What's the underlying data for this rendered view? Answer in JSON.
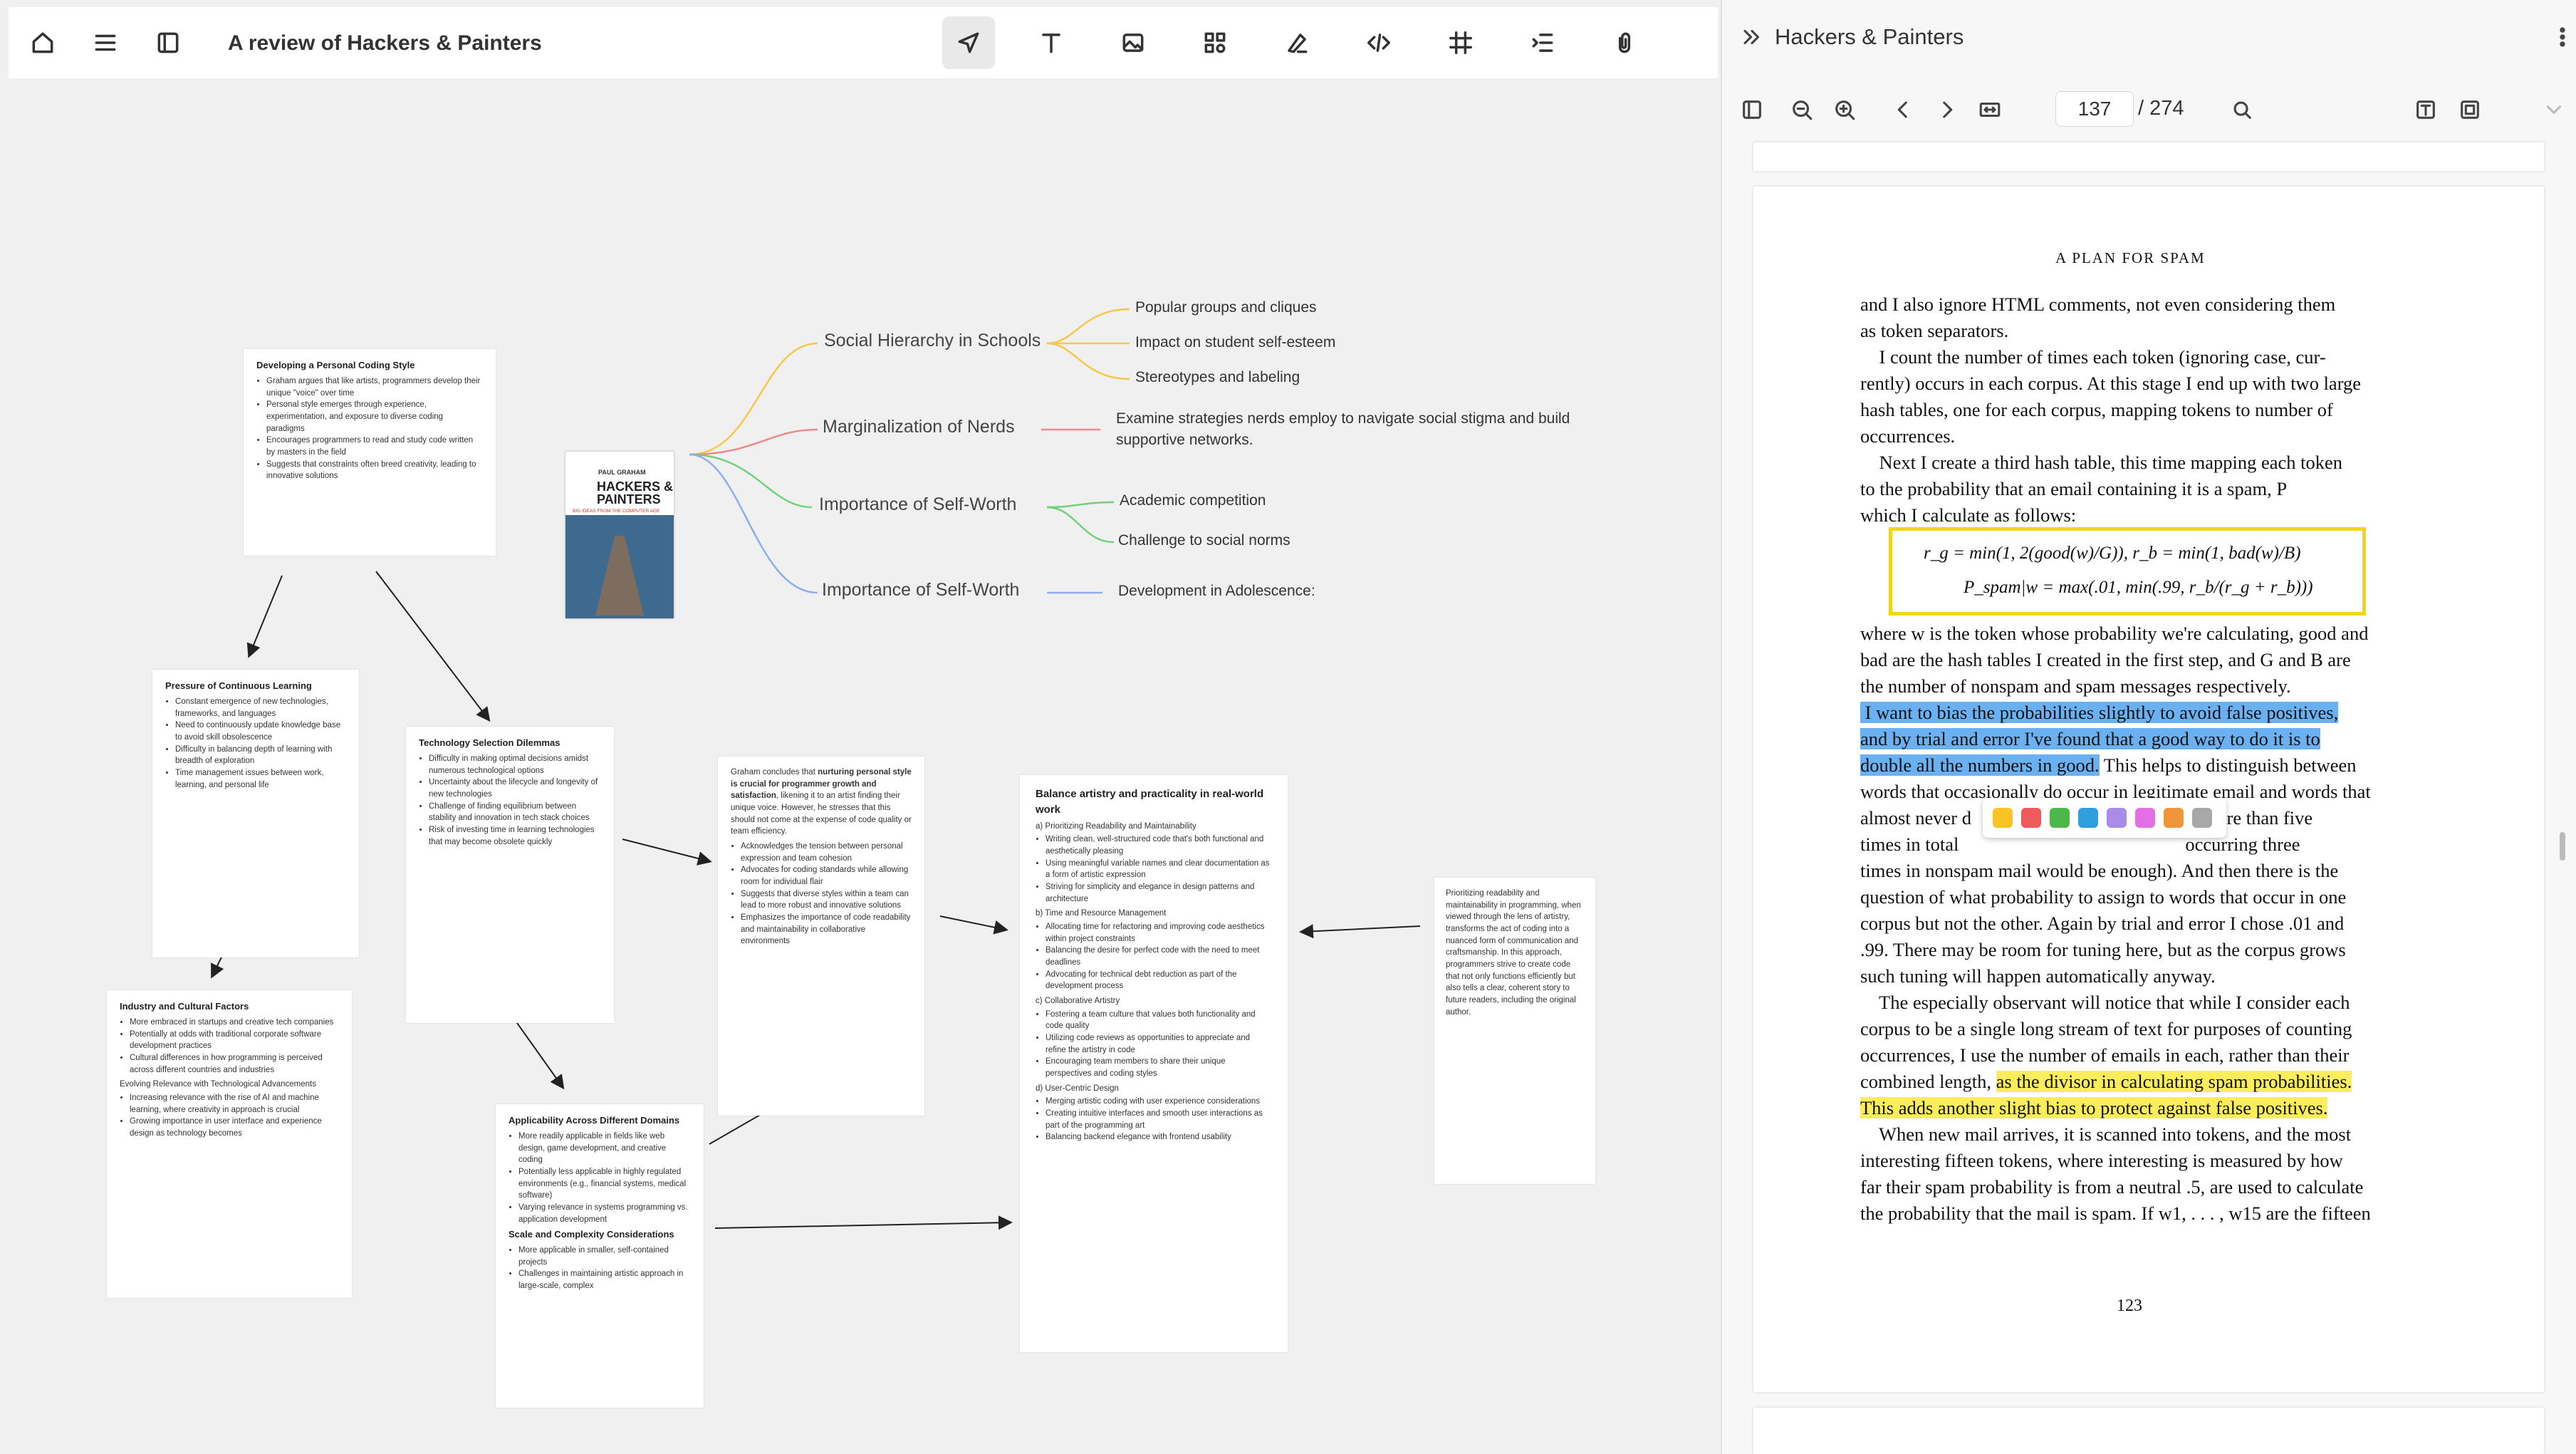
{
  "topbar": {
    "title": "A review of Hackers & Painters",
    "icons": [
      "home-icon",
      "menu-icon",
      "sidebar-icon",
      "send-icon",
      "text-icon",
      "image-icon",
      "grid-icon",
      "pen-icon",
      "code-icon",
      "frame-icon",
      "outline-icon",
      "attachment-icon"
    ]
  },
  "mindmap": {
    "nodes": [
      {
        "label": "Social Hierarchy in Schools",
        "color": "#f5c84a",
        "leaves": [
          "Popular groups and cliques",
          "Impact on student self-esteem",
          "Stereotypes and labeling"
        ]
      },
      {
        "label": "Marginalization of Nerds",
        "color": "#ef8a8a",
        "leaves": [
          "Examine strategies nerds employ to navigate social stigma and build",
          "supportive networks."
        ]
      },
      {
        "label": "Importance of Self-Worth",
        "color": "#6fd27a",
        "leaves": [
          "Academic competition",
          "Challenge to social norms"
        ]
      },
      {
        "label": "Importance of Self-Worth",
        "color": "#8aaef0",
        "leaves": [
          "Development in Adolescence:"
        ]
      }
    ]
  },
  "book_cover": {
    "author": "PAUL GRAHAM",
    "title_line1": "HACKERS &",
    "title_line2": "PAINTERS",
    "subtitle": "BIG IDEAS FROM THE COMPUTER AGE"
  },
  "cards": {
    "coding_style": {
      "title": "Developing a Personal Coding Style",
      "items": [
        "Graham argues that like artists, programmers develop their unique \"voice\" over time",
        "Personal style emerges through experience, experimentation, and exposure to diverse coding paradigms",
        "Encourages programmers to read and study code written by masters in the field",
        "Suggests that constraints often breed creativity, leading to innovative solutions"
      ]
    },
    "continuous_learning": {
      "title": "Pressure of Continuous Learning",
      "items": [
        "Constant emergence of new technologies, frameworks, and languages",
        "Need to continuously update knowledge base to avoid skill obsolescence",
        "Difficulty in balancing depth of learning with breadth of exploration",
        "Time management issues between work, learning, and personal life"
      ]
    },
    "tech_selection": {
      "title": "Technology Selection Dilemmas",
      "items": [
        "Difficulty in making optimal decisions amidst numerous technological options",
        "Uncertainty about the lifecycle and longevity of new technologies",
        "Challenge of finding equilibrium between stability and innovation in tech stack choices",
        "Risk of investing time in learning technologies that may become obsolete quickly"
      ]
    },
    "industry": {
      "title": "Industry and Cultural Factors",
      "items": [
        "More embraced in startups and creative tech companies",
        "Potentially at odds with traditional corporate software development practices",
        "Cultural differences in how programming is perceived across different countries and industries"
      ],
      "subtitle": "Evolving Relevance with Technological Advancements",
      "items2": [
        "Increasing relevance with the rise of AI and machine learning, where creativity in approach is crucial",
        "Growing importance in user interface and experience design as technology becomes"
      ]
    },
    "applicability": {
      "title": "Applicability Across Different Domains",
      "items": [
        "More readily applicable in fields like web design, game development, and creative coding",
        "Potentially less applicable in highly regulated environments (e.g., financial systems, medical software)",
        "Varying relevance in systems programming vs. application development"
      ],
      "subtitle": "Scale and Complexity Considerations",
      "items2": [
        "More applicable in smaller, self-contained projects",
        "Challenges in maintaining artistic approach in large-scale, complex"
      ]
    },
    "conclusion": {
      "intro_a": "Graham concludes that ",
      "intro_b": "nurturing personal style is crucial for programmer growth and satisfaction",
      "intro_c": ", likening it to an artist finding their unique voice. However, he stresses that this should not come at the expense of code quality or team efficiency.",
      "items": [
        "Acknowledges the tension between personal expression and team cohesion",
        "Advocates for coding standards while allowing room for individual flair",
        "Suggests that diverse styles within a team can lead to more robust and innovative solutions",
        "Emphasizes the importance of code readability and maintainability in collaborative environments"
      ]
    },
    "balance": {
      "title": "Balance artistry and practicality in real-world work",
      "sections": [
        {
          "label": "a) Prioritizing Readability and Maintainability",
          "items": [
            "Writing clean, well-structured code that's both functional and aesthetically pleasing",
            "Using meaningful variable names and clear documentation as a form of artistic expression",
            "Striving for simplicity and elegance in design patterns and architecture"
          ]
        },
        {
          "label": "b) Time and Resource Management",
          "items": [
            "Allocating time for refactoring and improving code aesthetics within project constraints",
            "Balancing the desire for perfect code with the need to meet deadlines",
            "Advocating for technical debt reduction as part of the development process"
          ]
        },
        {
          "label": "c) Collaborative Artistry",
          "items": [
            "Fostering a team culture that values both functionality and code quality",
            "Utilizing code reviews as opportunities to appreciate and refine the artistry in code",
            "Encouraging team members to share their unique perspectives and coding styles"
          ]
        },
        {
          "label": "d) User-Centric Design",
          "items": [
            "Merging artistic coding with user experience considerations",
            "Creating intuitive interfaces and smooth user interactions as part of the programming art",
            "Balancing backend elegance with frontend usability"
          ]
        }
      ]
    },
    "readability": {
      "text": "Prioritizing readability and maintainability in programming, when viewed through the lens of artistry, transforms the act of coding into a nuanced form of communication and craftsmanship. In this approach, programmers strive to create code that not only functions efficiently but also tells a clear, coherent story to future readers, including the original author."
    }
  },
  "panel": {
    "title": "Hackers & Painters",
    "page_current": "137",
    "page_total": "/ 274",
    "running_head": "A PLAN FOR SPAM",
    "page_number": "123",
    "formula_1": "r_g = min(1, 2(good(w)/G)),   r_b = min(1, bad(w)/B)",
    "formula_2": "P_spam|w = max(.01, min(.99, r_b/(r_g + r_b)))",
    "lines": [
      "and I also ignore HTML comments, not even considering them",
      "as token separators.",
      "    I count the number of times each token (ignoring case, cur-",
      "rently) occurs in each corpus. At this stage I end up with two large",
      "hash tables, one for each corpus, mapping tokens to number of",
      "occurrences.",
      "    Next I create a third hash table, this time mapping each token",
      "to the probability that an email containing it is a spam, P",
      "which I calculate as follows:"
    ],
    "lines2": [
      "where w is the token whose probability we're calculating, good and",
      "bad are the hash tables I created in the first step, and G and B are",
      "the number of nonspam and spam messages respectively."
    ],
    "hl_blue_1": " I want to bias the probabilities slightly to avoid false positives,",
    "hl_blue_2": "and by trial and error I've found that a good way to do it is to",
    "hl_blue_3": "double all the numbers in good.",
    "hl_blue_3_rest": " This helps to distinguish between",
    "lines3": [
      "words that occasionally do occur in legitimate email and words that",
      "almost never d                                                 more than five",
      "times in total                                                occurring three",
      "times in nonspam mail would be enough). And then there is the",
      "question of what probability to assign to words that occur in one",
      "corpus but not the other. Again by trial and error I chose .01 and",
      ".99. There may be room for tuning here, but as the corpus grows",
      "such tuning will happen automatically anyway.",
      "    The especially observant will notice that while I consider each",
      "corpus to be a single long stream of text for purposes of counting",
      "occurrences, I use the number of emails in each, rather than their"
    ],
    "line_yel_pre": "combined length, ",
    "hl_yel_1": "as the divisor in calculating spam probabilities.",
    "hl_yel_2": "This adds another slight bias to protect against false positives.",
    "lines4": [
      "    When new mail arrives, it is scanned into tokens, and the most",
      "interesting fifteen tokens, where interesting is measured by how",
      "far their spam probability is from a neutral .5, are used to calculate",
      "the probability that the mail is spam. If w1, . . . , w15 are the fifteen"
    ],
    "highlight_colors": [
      "#f7c325",
      "#ef5a5a",
      "#4cb84c",
      "#2f9fe0",
      "#a98be8",
      "#e46fe4",
      "#f0953a",
      "#a8a8a8"
    ]
  }
}
